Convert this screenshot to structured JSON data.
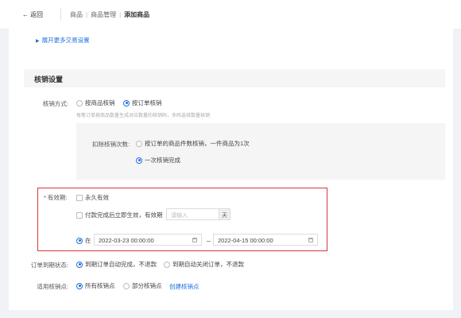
{
  "header": {
    "back_label": "返回",
    "breadcrumb": [
      "商品",
      "商品管理",
      "添加商品"
    ]
  },
  "expand_link": "展开更多交易设置",
  "section_title": "核销设置",
  "verify_method": {
    "label": "核销方式:",
    "options": [
      "按商品核销",
      "按订单核销"
    ],
    "selected": 1,
    "hint": "每笔订单按商品数量生成对应数量的核销码，多码选择数量核销"
  },
  "deduct": {
    "label": "扣除核销次数:",
    "options": [
      "按订单的商品件数核销，一件商品为1次",
      "一次核销完成"
    ],
    "selected": 1
  },
  "validity": {
    "label": "有效期:",
    "required_mark": "*",
    "forever": "永久有效",
    "after_pay": "付款完成后立即生效，有效期",
    "days_placeholder": "请输入",
    "days_unit": "天",
    "range_label": "在",
    "start_date": "2022-03-23 00:00:00",
    "end_date": "2022-04-15 00:00:00"
  },
  "expire_status": {
    "label": "订单到期状态:",
    "options": [
      "到期订单自动完成，不退款",
      "到期自动关闭订单，不退款"
    ],
    "selected": 0
  },
  "verify_point": {
    "label": "适用核销点:",
    "options": [
      "所有核销点",
      "部分核销点"
    ],
    "selected": 0,
    "create_link": "创建核销点"
  },
  "colors": {
    "accent": "#1f6fe0",
    "highlight_border": "#d9363e"
  }
}
